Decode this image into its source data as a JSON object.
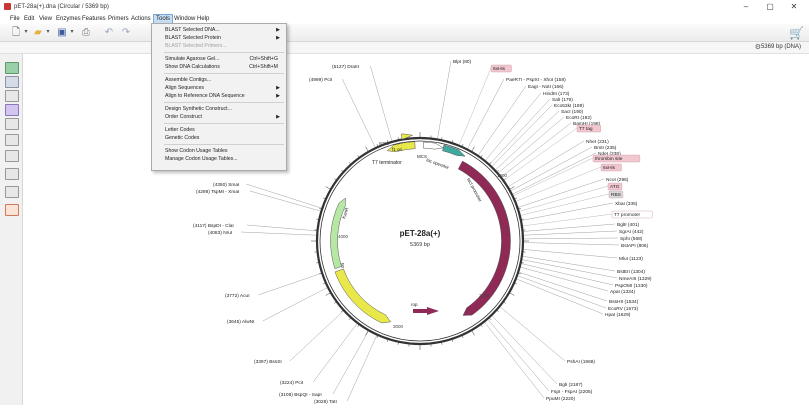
{
  "window": {
    "title": "pET-28a(+).dna  (Circular / 5369 bp)",
    "minimize_glyph": "–",
    "maximize_glyph": "▢",
    "close_glyph": "✕"
  },
  "menubar": {
    "items": [
      "File",
      "Edit",
      "View",
      "Enzymes",
      "Features",
      "Primers",
      "Actions",
      "Tools",
      "Window",
      "Help"
    ],
    "active_index": 7
  },
  "toolbar": {
    "icons": [
      "new-file-icon",
      "open-folder-icon",
      "save-icon",
      "print-icon",
      "undo-icon",
      "redo-icon"
    ]
  },
  "status": {
    "sequence_info": "5369 bp (DNA)"
  },
  "tools_menu": [
    {
      "label": "BLAST Selected DNA...",
      "submenu": true
    },
    {
      "label": "BLAST Selected Protein",
      "submenu": true
    },
    {
      "label": "BLAST Selected Primers...",
      "disabled": true
    },
    {
      "separator": true
    },
    {
      "label": "Simulate Agarose Gel...",
      "shortcut": "Ctrl+Shift+G"
    },
    {
      "label": "Show DNA Calculations",
      "shortcut": "Ctrl+Shift+M"
    },
    {
      "separator": true
    },
    {
      "label": "Assemble Contigs..."
    },
    {
      "label": "Align Sequences",
      "submenu": true
    },
    {
      "label": "Align to Reference DNA Sequence",
      "submenu": true
    },
    {
      "separator": true
    },
    {
      "label": "Design Synthetic Construct..."
    },
    {
      "label": "Order Construct",
      "submenu": true
    },
    {
      "separator": true
    },
    {
      "label": "Letter Codes"
    },
    {
      "label": "Genetic Codes"
    },
    {
      "separator": true
    },
    {
      "label": "Show Codon Usage Tables"
    },
    {
      "label": "Manage Codon Usage Tables..."
    }
  ],
  "plasmid": {
    "name": "pET-28a(+)",
    "length": "5369 bp",
    "tick_labels": [
      "5000",
      "1000",
      "2000",
      "3000",
      "4000"
    ],
    "features": [
      {
        "label": "T7 terminator",
        "color": "#e8e84a"
      },
      {
        "label": "f1 ori",
        "color": "#e8e84a"
      },
      {
        "label": "KanR",
        "color": "#b6e8a4"
      },
      {
        "label": "lacI",
        "color": "#8e2a55"
      },
      {
        "label": "lac operator",
        "color": "#3fa9a0"
      },
      {
        "label": "lacI promoter",
        "color": "#8e2a55"
      },
      {
        "label": "ori",
        "color": "#e8e84a"
      },
      {
        "label": "rop",
        "color": "#8e2a55"
      },
      {
        "label": "MCS",
        "color": "#ffffff"
      }
    ],
    "right_sites": [
      "BlpI (80)",
      "PaeR7I - PspXI - XhoI (158)",
      "EagI - NotI (166)",
      "HindIII (173)",
      "SalI (179)",
      "Eco53kI (189)",
      "SacI (190)",
      "EcoRI (192)",
      "BamHI (198)",
      "NheI (231)",
      "BmtI (235)",
      "NdeI (238)",
      "NcoI (296)",
      "XbaI (335)",
      "BglII (401)",
      "SgrAI (442)",
      "SphI (568)",
      "BstAPI (806)",
      "MluI (1123)",
      "BstEII (1304)",
      "NmeAIII (1329)",
      "PspOMI (1330)",
      "ApaI (1334)",
      "BssHII (1534)",
      "EcoRV (1573)",
      "HpaI (1629)",
      "PshAI (1968)",
      "BglI (2187)",
      "FspI - FspAI (2205)",
      "PpuMI (2220)"
    ],
    "right_tags": [
      "6xHis",
      "T7 tag",
      "thrombin site",
      "6xHis",
      "ATG",
      "RBS",
      "T7 promoter"
    ],
    "left_sites": [
      "(5127)  DraIII",
      "(4999)  PciI",
      "(4350)  SmaI",
      "(4298)  TspMI - XmaI",
      "(4117)  BspDI - ClaI",
      "(4083)  NruI",
      "(3772)  AcuI",
      "(3645)  AlwNI",
      "(3397)  BssSI",
      "(3224)  PciI",
      "(3108)  BspQI - SapI",
      "(3028)  TatI"
    ],
    "small_marks": [
      "Bsu36I (..)"
    ]
  }
}
